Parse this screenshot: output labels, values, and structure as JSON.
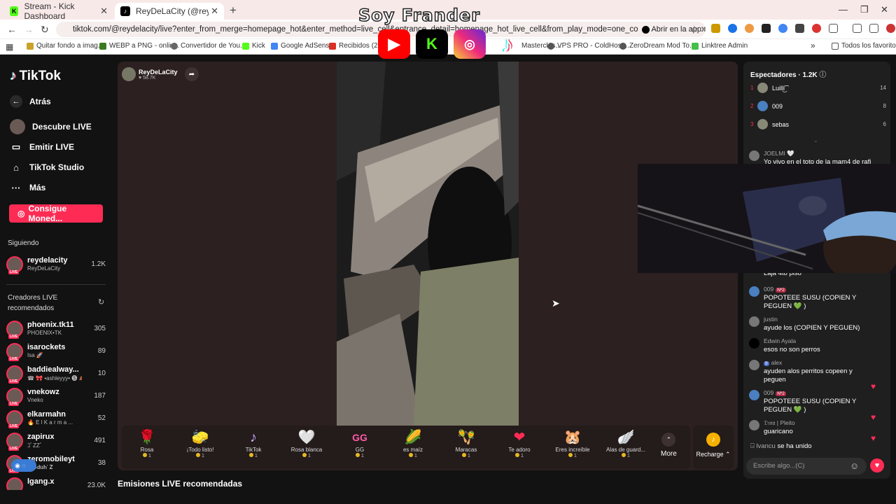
{
  "browser": {
    "tabs": [
      {
        "title": "Stream - Kick Dashboard",
        "favicon": "kick-icon"
      },
      {
        "title": "ReyDeLaCity (@reydelacity)",
        "favicon": "tiktok-icon",
        "active": true
      }
    ],
    "url": "tiktok.com/@reydelacity/live?enter_from_merge=homepage_hot&enter_method=live_cell&entrance_detail=homepage_hot_live_cell&from_play_mode=one_column&is_guest_connect=0&i...",
    "open_in_app": "Abrir en la app",
    "bookmarks": [
      "Quitar fondo a imag...",
      "WEBP a PNG - onlin...",
      "Convertidor de You...",
      "Kick",
      "Google AdSense",
      "Recibidos (2,229",
      "Masterclas...",
      "VPS PRO - ColdHost...",
      "ZeroDream Mod To...",
      "Linktree Admin"
    ],
    "all_bookmarks": "Todos los favoritos"
  },
  "overlay": {
    "title": "Soy Frander"
  },
  "sidebar": {
    "logo": "TikTok",
    "nav": [
      {
        "label": "Atrás",
        "icon": "arrow-left-icon"
      },
      {
        "label": "Descubre LIVE",
        "icon": "live-avatar-icon"
      },
      {
        "label": "Emitir LIVE",
        "icon": "camera-icon"
      },
      {
        "label": "TikTok Studio",
        "icon": "home-icon"
      },
      {
        "label": "Más",
        "icon": "more-dots-icon"
      }
    ],
    "coins_button": "Consigue Moned...",
    "following_title": "Siguiendo",
    "following": [
      {
        "name": "reydelacity",
        "sub": "ReyDeLaCity",
        "count": "1.2K"
      }
    ],
    "recommended_title": "Creadores LIVE recomendados",
    "recommended": [
      {
        "name": "phoenix.tk11",
        "sub": "PHOENIX•TK",
        "count": "305"
      },
      {
        "name": "isarockets",
        "sub": "Isa 🚀",
        "count": "89"
      },
      {
        "name": "baddiealway...",
        "sub": "☎ 🎀 •ashleyyy• 🅢 🍂",
        "count": "10"
      },
      {
        "name": "vnekowz",
        "sub": "Vneko",
        "count": "187"
      },
      {
        "name": "elkarmahn",
        "sub": "🔥 E l  K a r m a ...",
        "count": "52"
      },
      {
        "name": "zapirux",
        "sub": "ｺﾞZZﾞ",
        "count": "491"
      },
      {
        "name": "zeromobileyt",
        "sub": "𝐓𝐫𝐨𝐝𝐮𝐡' 𝐙",
        "count": "38"
      },
      {
        "name": "lgang.x",
        "sub": "",
        "count": "23.0K"
      }
    ]
  },
  "host": {
    "name": "ReyDeLaCity",
    "likes": "58.7K"
  },
  "gifts": [
    {
      "name": "Rosa",
      "price": "1",
      "icon": "🌹"
    },
    {
      "name": "¡Todo listo!",
      "price": "1",
      "icon": "🧽"
    },
    {
      "name": "TikTok",
      "price": "1",
      "icon": "♪"
    },
    {
      "name": "Rosa blanca",
      "price": "1",
      "icon": "🤍"
    },
    {
      "name": "GG",
      "price": "1",
      "icon": "GG"
    },
    {
      "name": "es maíz",
      "price": "1",
      "icon": "🌽"
    },
    {
      "name": "Maracas",
      "price": "1",
      "icon": "🪇"
    },
    {
      "name": "Te adoro",
      "price": "1",
      "icon": "❤"
    },
    {
      "name": "Eres increíble",
      "price": "1",
      "icon": "🐹"
    },
    {
      "name": "Alas de guard...",
      "price": "1",
      "icon": "🪽"
    }
  ],
  "more_label": "More",
  "recharge_label": "Recharge",
  "recommended_streams": "Emisiones LIVE recomendadas",
  "chat": {
    "viewers_label": "Espectadores · 1.2K",
    "top_viewers": [
      {
        "rank": "1",
        "name": "Luilli͜͡",
        "score": "14"
      },
      {
        "rank": "2",
        "name": "009",
        "score": "8"
      },
      {
        "rank": "3",
        "name": "sebas",
        "score": "6"
      }
    ],
    "messages": [
      {
        "user": "JOELMI 🤍",
        "text": "Yo vivo en el toto de la mam4 de rafi"
      },
      {
        "user": "",
        "text": "Laja 4to piso"
      },
      {
        "user": "009",
        "badge": "Nº2",
        "text": "POPOTEEE SUSU (COPIEN Y PEGUEN 💚 )"
      },
      {
        "user": "justin",
        "text": "ayude los (COPIEN Y PEGUEN)"
      },
      {
        "user": "Edwin Ayala",
        "text": "esos no son perros"
      },
      {
        "user": "alex",
        "badge": "9",
        "text": "ayuden alos perritos copeen y peguen"
      },
      {
        "user": "009",
        "badge": "Nº2",
        "text": "POPOTEEE SUSU (COPIEN Y PEGUEN 💚 )"
      },
      {
        "user": "𝔇𝔪𝔞 | Pleito",
        "text": "guaricano"
      }
    ],
    "joined_user": "lvancu",
    "joined_text": "se ha unido",
    "input_placeholder": "Escribe algo...(C)"
  }
}
